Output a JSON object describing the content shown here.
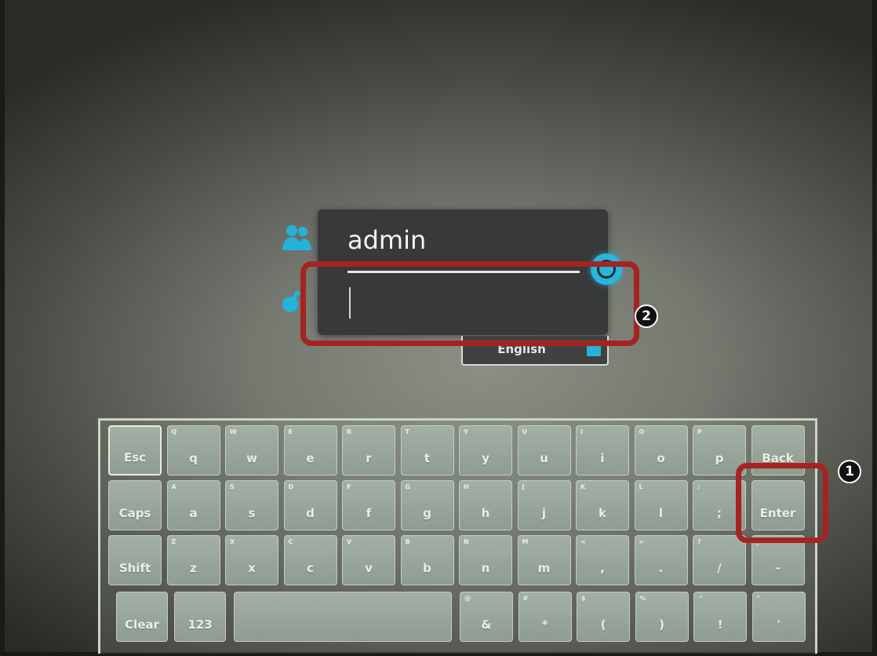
{
  "login": {
    "username": "admin",
    "password_value": "",
    "language": "English"
  },
  "keyboard": {
    "row1": [
      {
        "main": "Esc",
        "sub": ""
      },
      {
        "main": "q",
        "sub": "Q"
      },
      {
        "main": "w",
        "sub": "W"
      },
      {
        "main": "e",
        "sub": "E"
      },
      {
        "main": "r",
        "sub": "R"
      },
      {
        "main": "t",
        "sub": "T"
      },
      {
        "main": "y",
        "sub": "Y"
      },
      {
        "main": "u",
        "sub": "U"
      },
      {
        "main": "i",
        "sub": "I"
      },
      {
        "main": "o",
        "sub": "O"
      },
      {
        "main": "p",
        "sub": "P"
      },
      {
        "main": "Back",
        "sub": ""
      }
    ],
    "row2": [
      {
        "main": "Caps",
        "sub": ""
      },
      {
        "main": "a",
        "sub": "A"
      },
      {
        "main": "s",
        "sub": "S"
      },
      {
        "main": "d",
        "sub": "D"
      },
      {
        "main": "f",
        "sub": "F"
      },
      {
        "main": "g",
        "sub": "G"
      },
      {
        "main": "h",
        "sub": "H"
      },
      {
        "main": "j",
        "sub": "J"
      },
      {
        "main": "k",
        "sub": "K"
      },
      {
        "main": "l",
        "sub": "L"
      },
      {
        "main": ";",
        "sub": ":"
      },
      {
        "main": "Enter",
        "sub": ""
      }
    ],
    "row3": [
      {
        "main": "Shift",
        "sub": ""
      },
      {
        "main": "z",
        "sub": "Z"
      },
      {
        "main": "x",
        "sub": "X"
      },
      {
        "main": "c",
        "sub": "C"
      },
      {
        "main": "v",
        "sub": "V"
      },
      {
        "main": "b",
        "sub": "B"
      },
      {
        "main": "n",
        "sub": "N"
      },
      {
        "main": "m",
        "sub": "M"
      },
      {
        "main": ",",
        "sub": "<"
      },
      {
        "main": ".",
        "sub": ">"
      },
      {
        "main": "/",
        "sub": "?"
      },
      {
        "main": "-",
        "sub": "_"
      }
    ],
    "row4": [
      {
        "main": "Clear",
        "sub": ""
      },
      {
        "main": "123",
        "sub": ""
      },
      {
        "main": "",
        "sub": ""
      },
      {
        "main": "&",
        "sub": "@"
      },
      {
        "main": "*",
        "sub": "#"
      },
      {
        "main": "(",
        "sub": "$"
      },
      {
        "main": ")",
        "sub": "%"
      },
      {
        "main": "!",
        "sub": "^"
      },
      {
        "main": "'",
        "sub": "\""
      }
    ]
  },
  "annotations": {
    "one": "1",
    "two": "2",
    "color": "#a52422"
  },
  "icons": {
    "user": "users-icon",
    "key": "key-icon",
    "go": "arrow-circle-icon",
    "language": "keyboard-icon"
  }
}
